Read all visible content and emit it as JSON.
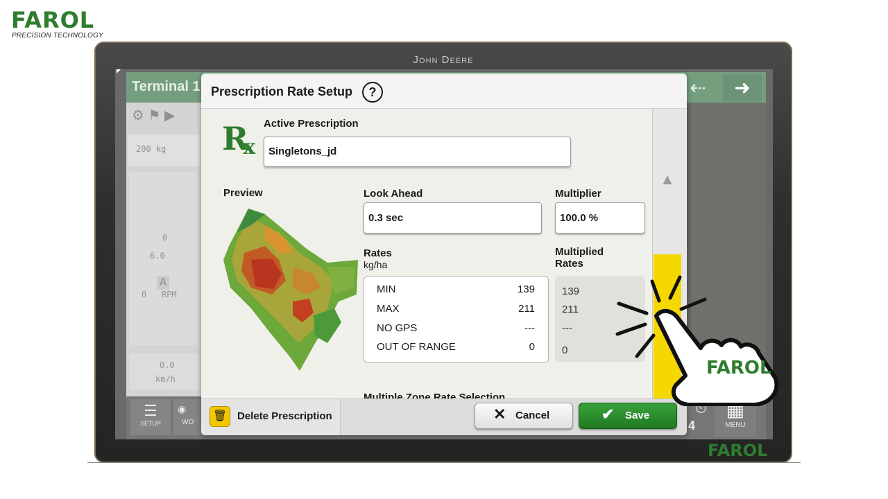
{
  "branding": {
    "logo": "FAROL",
    "tagline": "PRECISION TECHNOLOGY",
    "monitor_brand": "John Deere",
    "watermark": "FAROL",
    "hand_badge": "FAROL"
  },
  "background_terminal": {
    "title": "Terminal 1",
    "rate_text": "200 kg",
    "gauge_values": [
      "0",
      "6.0",
      "0   RPM"
    ],
    "a_label": "A",
    "speed_value": "0.0",
    "speed_unit": "km/h",
    "setup_label": "SETUP",
    "wo_label": "WO",
    "num_indicator": "4",
    "menu_label": "MENU"
  },
  "dialog": {
    "title": "Prescription Rate Setup",
    "help_icon": "?",
    "rx_icon": "R",
    "active_prescription_label": "Active Prescription",
    "active_prescription_value": "Singletons_jd",
    "preview_label": "Preview",
    "look_ahead_label": "Look Ahead",
    "look_ahead_value": "0.3 sec",
    "multiplier_label": "Multiplier",
    "multiplier_value": "100.0 %",
    "rates_label": "Rates",
    "rates_unit": "kg/ha",
    "rates": [
      {
        "name": "MIN",
        "value": "139"
      },
      {
        "name": "MAX",
        "value": "211"
      },
      {
        "name": "NO GPS",
        "value": "---"
      },
      {
        "name": "OUT OF RANGE",
        "value": "0"
      }
    ],
    "multiplied_rates_label": "Multiplied Rates",
    "multiplied_rates": [
      "139",
      "211",
      "---",
      "0"
    ],
    "multiple_zone_label": "Multiple Zone Rate Selection",
    "delete_label": "Delete Prescription",
    "cancel_label": "Cancel",
    "save_label": "Save"
  },
  "colors": {
    "jd_green": "#2a6a3a",
    "save_green": "#1f7a22",
    "scroll_yellow": "#f5d800",
    "brand_green": "#2e7d2e"
  }
}
